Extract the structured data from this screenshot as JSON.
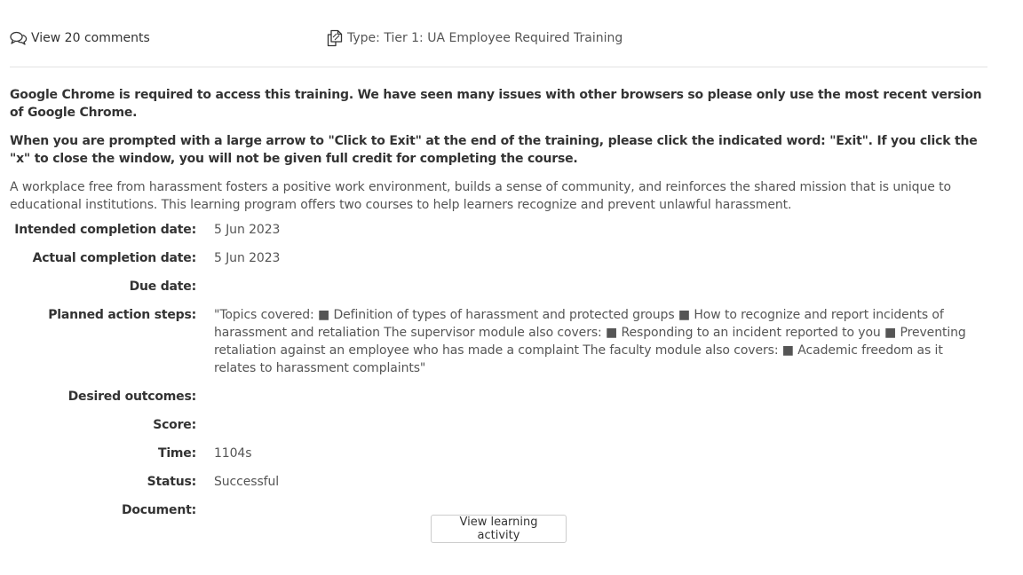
{
  "header": {
    "comments_link": "View 20 comments",
    "type_label": "Type: Tier 1: UA Employee Required Training",
    "comments_icon": "comments-icon",
    "type_icon": "copy-icon"
  },
  "notes": {
    "chrome_notice": "Google Chrome is required to access this training. We have seen many issues with other browsers so please only use the most recent version of Google Chrome.",
    "exit_notice": "When you are prompted with a large arrow to \"Click to Exit\" at the end of the training, please click the indicated word: \"Exit\". If you click the \"x\" to close the window, you will not be given full credit for completing the course.",
    "description": "A workplace free from harassment fosters a positive work environment, builds a sense of community, and reinforces the shared mission that is unique to educational institutions. This learning program offers two courses to help learners recognize and prevent unlawful harassment."
  },
  "details": {
    "intended_completion": {
      "label": "Intended completion date:",
      "value": "5 Jun 2023"
    },
    "actual_completion": {
      "label": "Actual completion date:",
      "value": "5 Jun 2023"
    },
    "due_date": {
      "label": "Due date:",
      "value": ""
    },
    "planned_steps": {
      "label": "Planned action steps:",
      "value": "\"Topics covered: ■ Definition of types of harassment and protected groups ■ How to recognize and report incidents of harassment and retaliation The supervisor module also covers: ■ Responding to an incident reported to you ■ Preventing retaliation against an employee who has made a complaint The faculty module also covers: ■ Academic freedom as it relates to harassment complaints\""
    },
    "desired_outcomes": {
      "label": "Desired outcomes:",
      "value": ""
    },
    "score": {
      "label": "Score:",
      "value": ""
    },
    "time": {
      "label": "Time:",
      "value": "1104s"
    },
    "status": {
      "label": "Status:",
      "value": "Successful"
    },
    "document": {
      "label": "Document:",
      "value": ""
    }
  },
  "actions": {
    "view_activity": "View learning activity"
  }
}
